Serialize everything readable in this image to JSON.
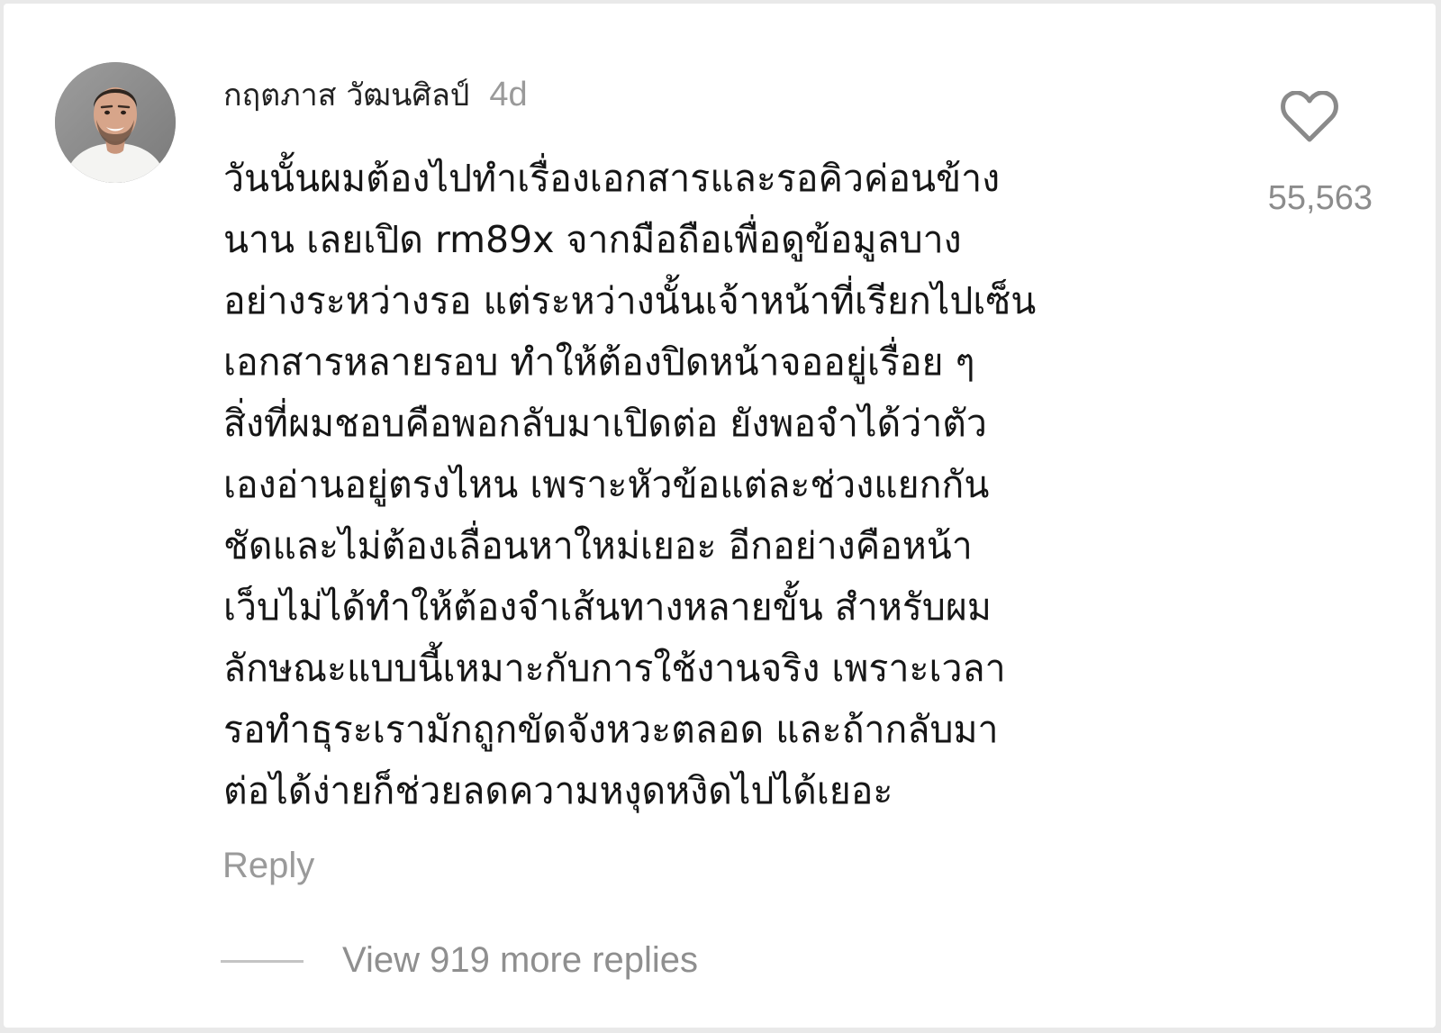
{
  "comment": {
    "author": "กฤตภาส วัฒนศิลป์",
    "timestamp": "4d",
    "avatar_icon": "user-avatar-photo",
    "lines": [
      "วันนั้นผมต้องไปทำเรื่องเอกสารและรอคิวค่อนข้าง",
      "นาน เลยเปิด rm89x จากมือถือเพื่อดูข้อมูลบาง",
      "อย่างระหว่างรอ แต่ระหว่างนั้นเจ้าหน้าที่เรียกไปเซ็น",
      "เอกสารหลายรอบ ทำให้ต้องปิดหน้าจออยู่เรื่อย ๆ",
      "สิ่งที่ผมชอบคือพอกลับมาเปิดต่อ ยังพอจำได้ว่าตัว",
      "เองอ่านอยู่ตรงไหน เพราะหัวข้อแต่ละช่วงแยกกัน",
      "ชัดและไม่ต้องเลื่อนหาใหม่เยอะ อีกอย่างคือหน้า",
      "เว็บไม่ได้ทำให้ต้องจำเส้นทางหลายขั้น สำหรับผม",
      "ลักษณะแบบนี้เหมาะกับการใช้งานจริง เพราะเวลา",
      "รอทำธุระเรามักถูกขัดจังหวะตลอด และถ้ากลับมา",
      "ต่อได้ง่ายก็ช่วยลดความหงุดหงิดไปได้เยอะ"
    ],
    "like_icon": "heart-outline-icon",
    "like_count": "55,563",
    "reply_label": "Reply",
    "view_replies_label": "View 919 more replies"
  }
}
